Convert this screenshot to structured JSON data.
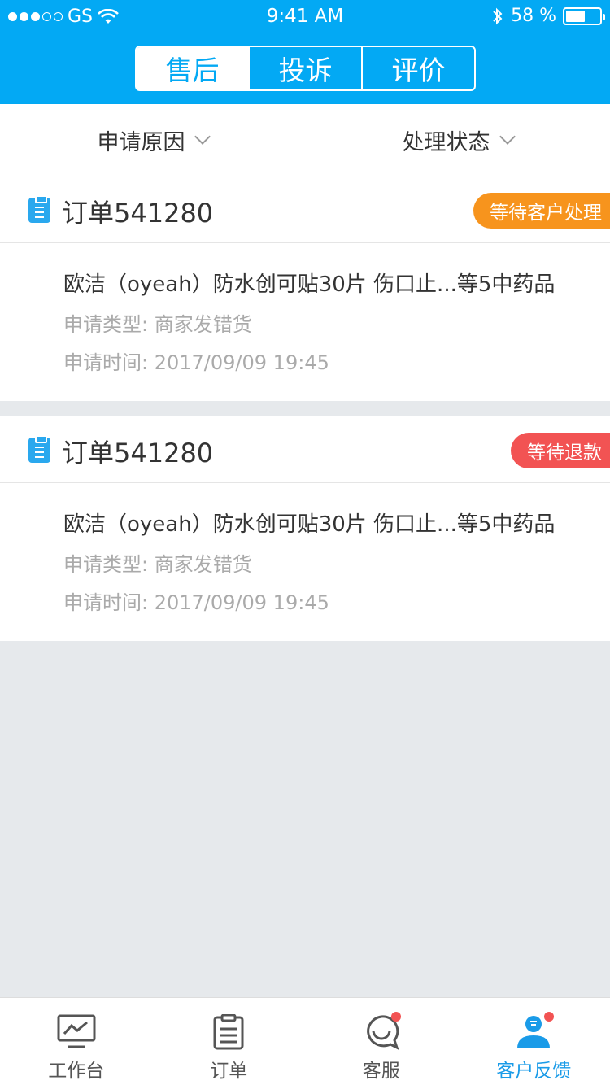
{
  "status_bar": {
    "carrier": "GS",
    "time": "9:41 AM",
    "battery_text": "58 %",
    "battery_level": 0.58
  },
  "segment": {
    "items": [
      {
        "label": "售后",
        "active": true
      },
      {
        "label": "投诉",
        "active": false
      },
      {
        "label": "评价",
        "active": false
      }
    ]
  },
  "filter": {
    "reason_label": "申请原因",
    "status_label": "处理状态"
  },
  "orders": [
    {
      "title": "订单541280",
      "badge": "等待客户处理",
      "badge_color": "#f7941d",
      "product": "欧洁（oyeah）防水创可贴30片 伤口止...等5中药品",
      "type_label": "申请类型: 商家发错货",
      "time_label": "申请时间: 2017/09/09 19:45"
    },
    {
      "title": "订单541280",
      "badge": "等待退款",
      "badge_color": "#f25353",
      "product": "欧洁（oyeah）防水创可贴30片 伤口止...等5中药品",
      "type_label": "申请类型: 商家发错货",
      "time_label": "申请时间: 2017/09/09 19:45"
    }
  ],
  "tabbar": {
    "items": [
      {
        "label": "工作台",
        "icon": "monitor-chart-icon",
        "active": false
      },
      {
        "label": "订单",
        "icon": "clipboard-list-icon",
        "active": false
      },
      {
        "label": "客服",
        "icon": "chat-smile-icon",
        "active": false,
        "dot": true
      },
      {
        "label": "客户反馈",
        "icon": "user-feedback-icon",
        "active": true,
        "dot": true
      }
    ]
  },
  "colors": {
    "primary": "#03a9f4",
    "badge_orange": "#f7941d",
    "badge_red": "#f25353",
    "active_tab": "#1a9be8"
  }
}
